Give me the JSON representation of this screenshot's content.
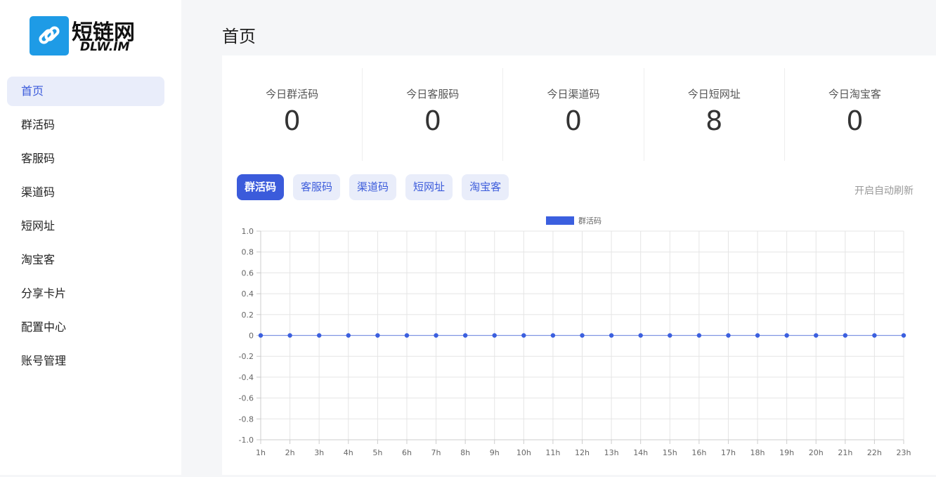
{
  "logo": {
    "title": "短链网",
    "subtitle": "DLW.IM"
  },
  "sidebar": {
    "items": [
      {
        "label": "首页",
        "active": true
      },
      {
        "label": "群活码"
      },
      {
        "label": "客服码"
      },
      {
        "label": "渠道码"
      },
      {
        "label": "短网址"
      },
      {
        "label": "淘宝客"
      },
      {
        "label": "分享卡片"
      },
      {
        "label": "配置中心"
      },
      {
        "label": "账号管理"
      }
    ]
  },
  "page": {
    "title": "首页"
  },
  "stats": [
    {
      "label": "今日群活码",
      "value": "0"
    },
    {
      "label": "今日客服码",
      "value": "0"
    },
    {
      "label": "今日渠道码",
      "value": "0"
    },
    {
      "label": "今日短网址",
      "value": "8"
    },
    {
      "label": "今日淘宝客",
      "value": "0"
    }
  ],
  "tabs": [
    {
      "label": "群活码",
      "active": true
    },
    {
      "label": "客服码"
    },
    {
      "label": "渠道码"
    },
    {
      "label": "短网址"
    },
    {
      "label": "淘宝客"
    }
  ],
  "refresh_label": "开启自动刷新",
  "colors": {
    "accent": "#3b5bdb",
    "series": "#3b5fdf"
  },
  "chart_data": {
    "type": "line",
    "categories": [
      "1h",
      "2h",
      "3h",
      "4h",
      "5h",
      "6h",
      "7h",
      "8h",
      "9h",
      "10h",
      "11h",
      "12h",
      "13h",
      "14h",
      "15h",
      "16h",
      "17h",
      "18h",
      "19h",
      "20h",
      "21h",
      "22h",
      "23h"
    ],
    "series": [
      {
        "name": "群活码",
        "values": [
          0,
          0,
          0,
          0,
          0,
          0,
          0,
          0,
          0,
          0,
          0,
          0,
          0,
          0,
          0,
          0,
          0,
          0,
          0,
          0,
          0,
          0,
          0
        ]
      }
    ],
    "ylim": [
      -1.0,
      1.0
    ],
    "yticks": [
      "1.0",
      "0.8",
      "0.6",
      "0.4",
      "0.2",
      "0",
      "-0.2",
      "-0.4",
      "-0.6",
      "-0.8",
      "-1.0"
    ],
    "grid": true,
    "legend": "top-center"
  }
}
